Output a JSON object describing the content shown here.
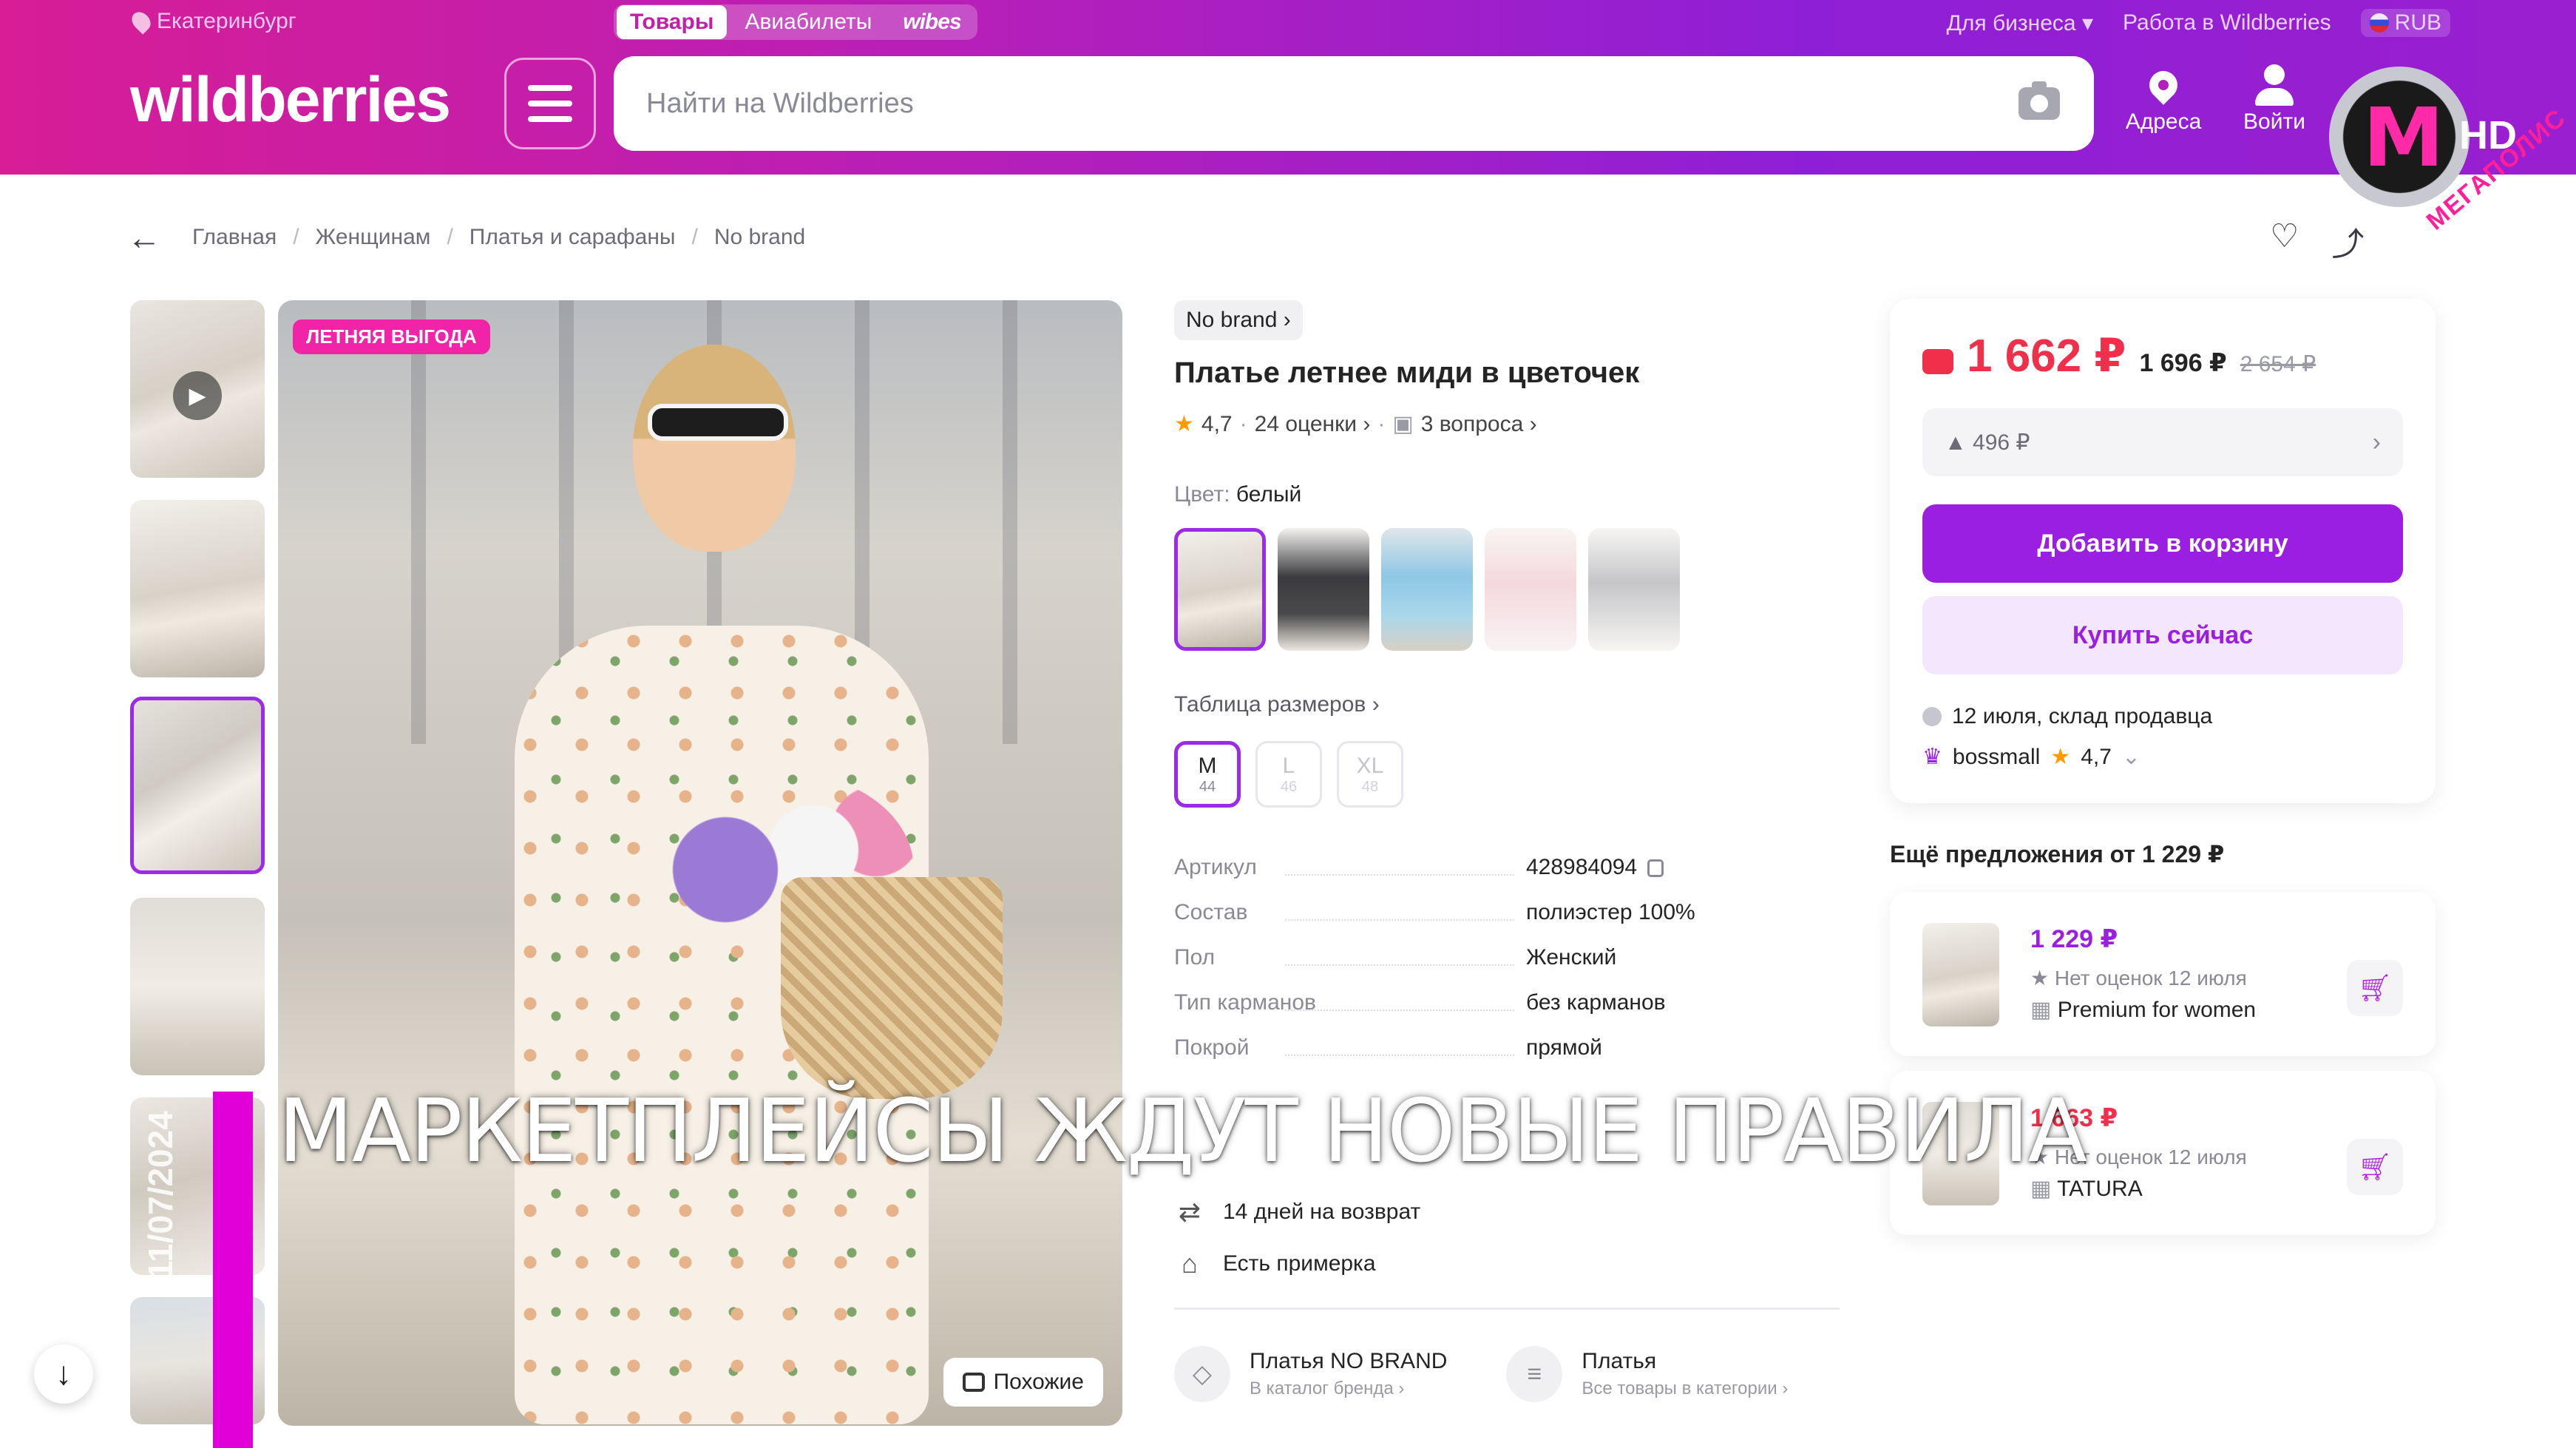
{
  "header": {
    "location": "Екатеринбург",
    "tabs": [
      {
        "label": "Товары",
        "active": true
      },
      {
        "label": "Авиабилеты",
        "active": false
      },
      {
        "label": "wibes",
        "active": false
      }
    ],
    "business": "Для бизнеса",
    "jobs": "Работа в Wildberries",
    "currency": "RUB",
    "logo": "wildberries",
    "search_placeholder": "Найти на Wildberries",
    "addresses": "Адреса",
    "login": "Войти"
  },
  "tv": {
    "channel": "МЕГАПОЛИС",
    "hd": "HD",
    "date": "11/07/2024",
    "ticker": "МАРКЕТПЛЕЙСЫ ЖДУТ НОВЫЕ ПРАВИЛА"
  },
  "breadcrumbs": [
    "Главная",
    "Женщинам",
    "Платья и сарафаны",
    "No brand"
  ],
  "gallery": {
    "promo_badge": "ЛЕТНЯЯ ВЫГОДА",
    "similar": "Похожие"
  },
  "product": {
    "brand": "No brand",
    "title": "Платье летнее миди в цветочек",
    "rating": "4,7",
    "reviews": "24 оценки",
    "questions": "3 вопроса",
    "color_label": "Цвет:",
    "color_value": "белый",
    "size_table": "Таблица размеров",
    "sizes": [
      {
        "label": "M",
        "ru": "44",
        "available": true
      },
      {
        "label": "L",
        "ru": "46",
        "available": false
      },
      {
        "label": "XL",
        "ru": "48",
        "available": false
      }
    ],
    "params": [
      {
        "key": "Артикул",
        "value": "428984094"
      },
      {
        "key": "Состав",
        "value": "полиэстер 100%"
      },
      {
        "key": "Пол",
        "value": "Женский"
      },
      {
        "key": "Тип карманов",
        "value": "без карманов"
      },
      {
        "key": "Покрой",
        "value": "прямой"
      }
    ],
    "perks": [
      "14 дней на возврат",
      "Есть примерка"
    ],
    "links": [
      {
        "title": "Платья NO BRAND",
        "sub": "В каталог бренда"
      },
      {
        "title": "Платья",
        "sub": "Все товары в категории"
      }
    ]
  },
  "buy": {
    "price": "1 662 ₽",
    "price_wallet": "1 696 ₽",
    "price_old": "2 654 ₽",
    "saving": "▲ 496 ₽",
    "add_to_cart": "Добавить в корзину",
    "buy_now": "Купить сейчас",
    "delivery": "12 июля, склад продавца",
    "seller": "bossmall",
    "seller_rating": "4,7"
  },
  "offers": {
    "title": "Ещё предложения от 1 229 ₽",
    "items": [
      {
        "price": "1 229 ₽",
        "no_reviews": "Нет оценок",
        "date": "12 июля",
        "seller": "Premium for women",
        "price_color": "#9b1fe0"
      },
      {
        "price": "1 663 ₽",
        "no_reviews": "Нет оценок",
        "date": "12 июля",
        "seller": "TATURA",
        "price_color": "#f0304a"
      }
    ]
  },
  "colors": {
    "accent": "#9b1fe0",
    "price_red": "#f0304a",
    "header_start": "#d81d96",
    "header_end": "#8f1fd6"
  }
}
